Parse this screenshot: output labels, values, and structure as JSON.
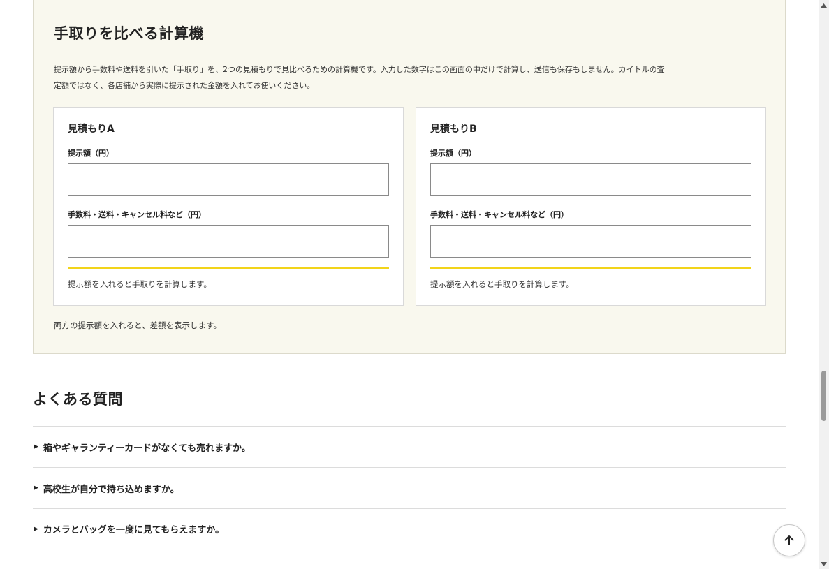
{
  "calculator": {
    "title": "手取りを比べる計算機",
    "description": "提示額から手数料や送料を引いた「手取り」を、2つの見積もりで見比べるための計算機です。入力した数字はこの画面の中だけで計算し、送信も保存もしません。カイトルの査定額ではなく、各店舗から実際に提示された金額を入れてお使いください。",
    "cards": [
      {
        "title": "見積もりA",
        "offer_label": "提示額（円）",
        "offer_value": "",
        "fee_label": "手数料・送料・キャンセル料など（円）",
        "fee_value": "",
        "result": "提示額を入れると手取りを計算します。"
      },
      {
        "title": "見積もりB",
        "offer_label": "提示額（円）",
        "offer_value": "",
        "fee_label": "手数料・送料・キャンセル料など（円）",
        "fee_value": "",
        "result": "提示額を入れると手取りを計算します。"
      }
    ],
    "difference_note": "両方の提示額を入れると、差額を表示します。"
  },
  "faq": {
    "title": "よくある質問",
    "items": [
      {
        "question": "箱やギャランティーカードがなくても売れますか。"
      },
      {
        "question": "高校生が自分で持ち込めますか。"
      },
      {
        "question": "カメラとバッグを一度に見てもらえますか。"
      }
    ]
  },
  "icons": {
    "faq_toggle": "triangle-right-icon",
    "back_to_top": "arrow-up-icon"
  },
  "colors": {
    "panel_bg": "#f9f8ee",
    "accent_bar": "#f2d41a"
  }
}
